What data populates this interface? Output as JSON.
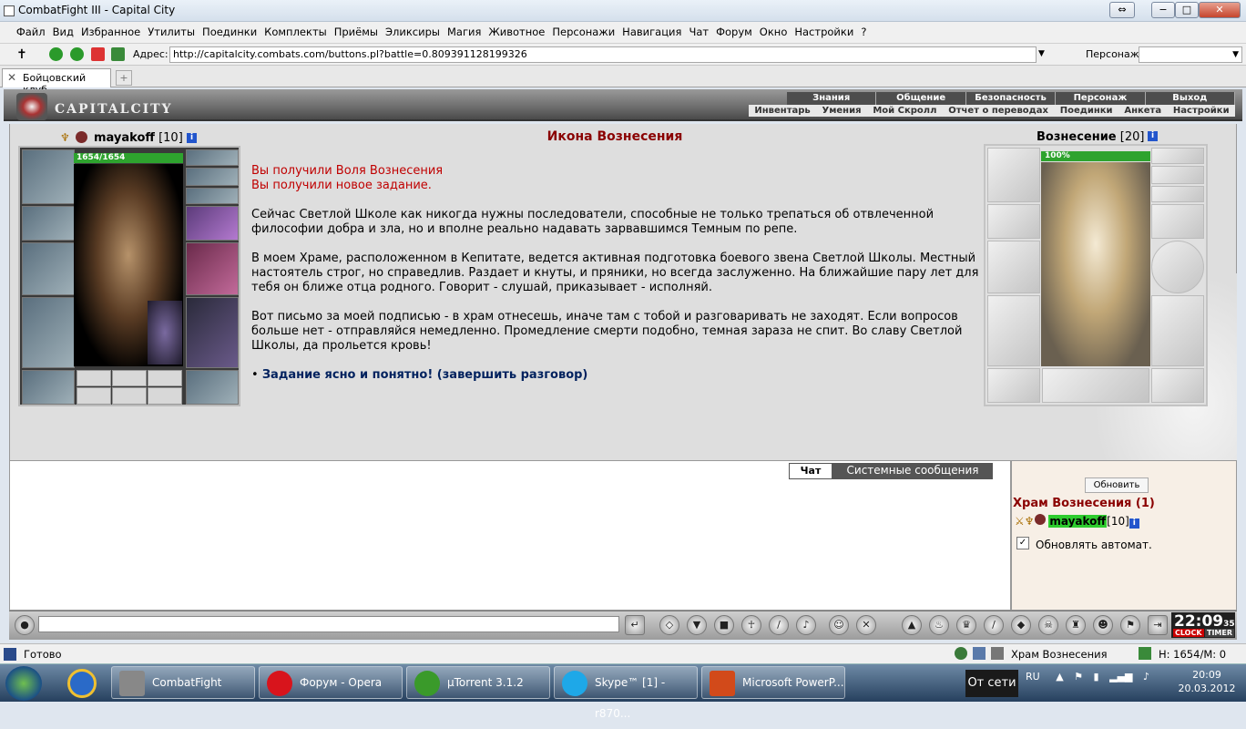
{
  "window": {
    "title": "CombatFight III - Capital City",
    "min": "−",
    "max": "□",
    "close": "✕"
  },
  "menu": [
    "Файл",
    "Вид",
    "Избранное",
    "Утилиты",
    "Поединки",
    "Комплекты",
    "Приёмы",
    "Эликсиры",
    "Магия",
    "Животное",
    "Персонажи",
    "Навигация",
    "Чат",
    "Форум",
    "Окно",
    "Настройки",
    "?"
  ],
  "address": {
    "label": "Адрес:",
    "url": "http://capitalcity.combats.com/buttons.pl?battle=0.809391128199326",
    "persona_label": "Персонаж:"
  },
  "tab": {
    "label": "Бойцовский клуб"
  },
  "game": {
    "logo": "CAPITALCITY",
    "topnav": [
      "Знания",
      "Общение",
      "Безопасность",
      "Персонаж",
      "Выход"
    ],
    "subnav": [
      "Инвентарь",
      "Умения",
      "Мой Скролл",
      "Отчет о переводах",
      "Поединки",
      "Анкета",
      "Настройки"
    ],
    "char": {
      "name": "mayakoff",
      "level": "[10]",
      "hp": "1654/1654"
    },
    "page_title": "Икона Вознесения",
    "messages": [
      "Вы получили Воля Вознесения",
      "Вы получили новое задание."
    ],
    "paragraphs": [
      "Сейчас Светлой Школе как никогда нужны последователи, способные не только трепаться об отвлеченной философии добра и зла, но и вполне реально надавать зарвавшимся Темным по репе.",
      "В моем Храме, расположенном в Кепитате, ведется активная подготовка боевого звена Светлой Школы. Местный настоятель строг, но справедлив. Раздает и кнуты, и пряники, но всегда заслуженно. На ближайшие пару лет для тебя он ближе отца родного. Говорит - слушай, приказывает - исполняй.",
      "Вот письмо за моей подписью - в храм отнесешь, иначе там с тобой и разговаривать не заходят. Если вопросов больше нет - отправляйся немедленно. Промедление смерти подобно, темная зараза не спит. Во славу Светлой Школы, да прольется кровь!"
    ],
    "action_bullet": "•",
    "action": "Задание ясно и понятно! (завершить разговор)",
    "npc": {
      "name": "Вознесение",
      "level": "[20]",
      "hp": "100%"
    }
  },
  "chat": {
    "tab_chat": "Чат",
    "tab_system": "Системные сообщения",
    "refresh": "Обновить",
    "room": "Храм Вознесения (1)",
    "user": "mayakoff",
    "user_level": "[10]",
    "auto_label": "Обновлять автомат.",
    "auto_checked": "✓"
  },
  "clock": {
    "time": "22:09",
    "sec": "35",
    "clock_label": "CLOCK",
    "timer_label": "TIMER"
  },
  "status": {
    "ready": "Готово",
    "location": "Храм Вознесения",
    "hp": "H: 1654/M: 0"
  },
  "taskbar": {
    "items": [
      "CombatFight",
      "Форум - Opera",
      "µTorrent 3.1.2",
      "Skype™ [1] - r870...",
      "Microsoft PowerP..."
    ],
    "net": "От сети",
    "lang": "RU",
    "time": "20:09",
    "date": "20.03.2012"
  }
}
